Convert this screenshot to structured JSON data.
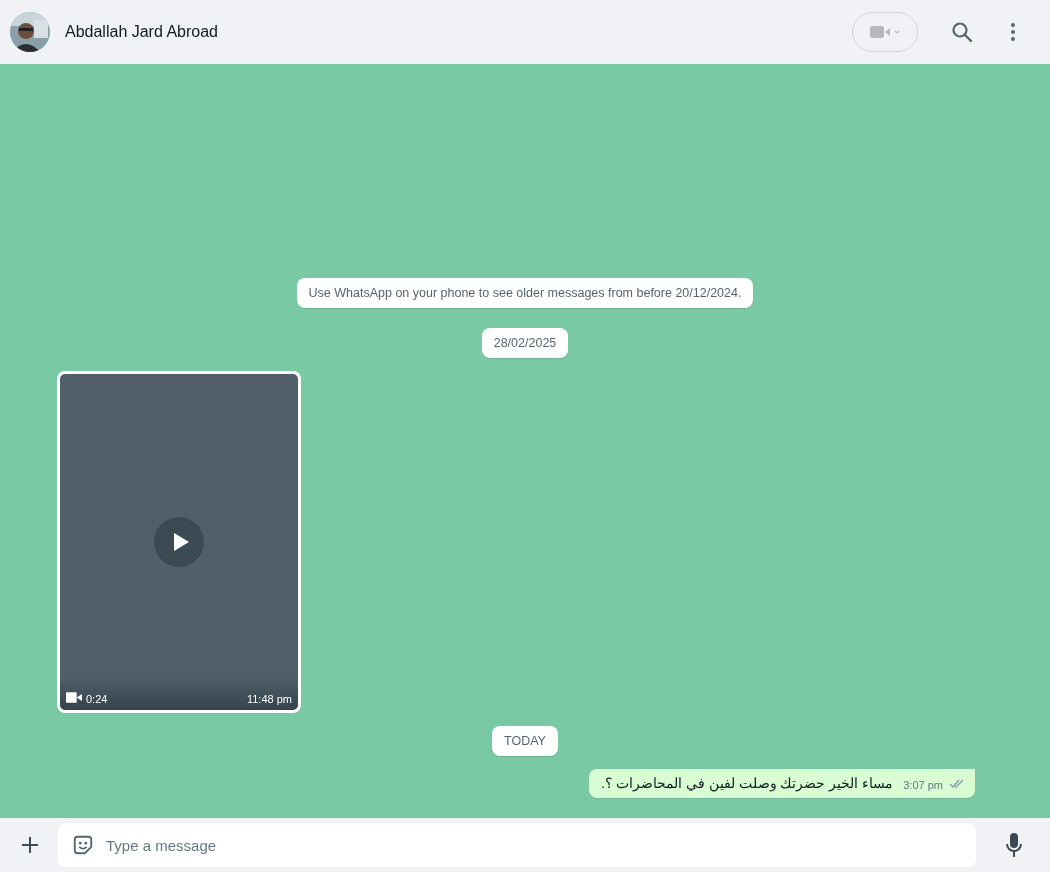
{
  "header": {
    "contact_name": "Abdallah Jard Abroad"
  },
  "messages": [
    {
      "kind": "system",
      "text": "Use WhatsApp on your phone to see older messages from before 20/12/2024."
    },
    {
      "kind": "date",
      "text": "28/02/2025"
    },
    {
      "kind": "video",
      "duration": "0:24",
      "time": "11:48 pm"
    },
    {
      "kind": "date",
      "text": "TODAY"
    },
    {
      "kind": "text",
      "text": "مساء الخير حضرتك وصلت لفين في المحاضرات ؟.",
      "time": "3:07 pm",
      "read": false
    }
  ],
  "composer": {
    "placeholder": "Type a message"
  }
}
